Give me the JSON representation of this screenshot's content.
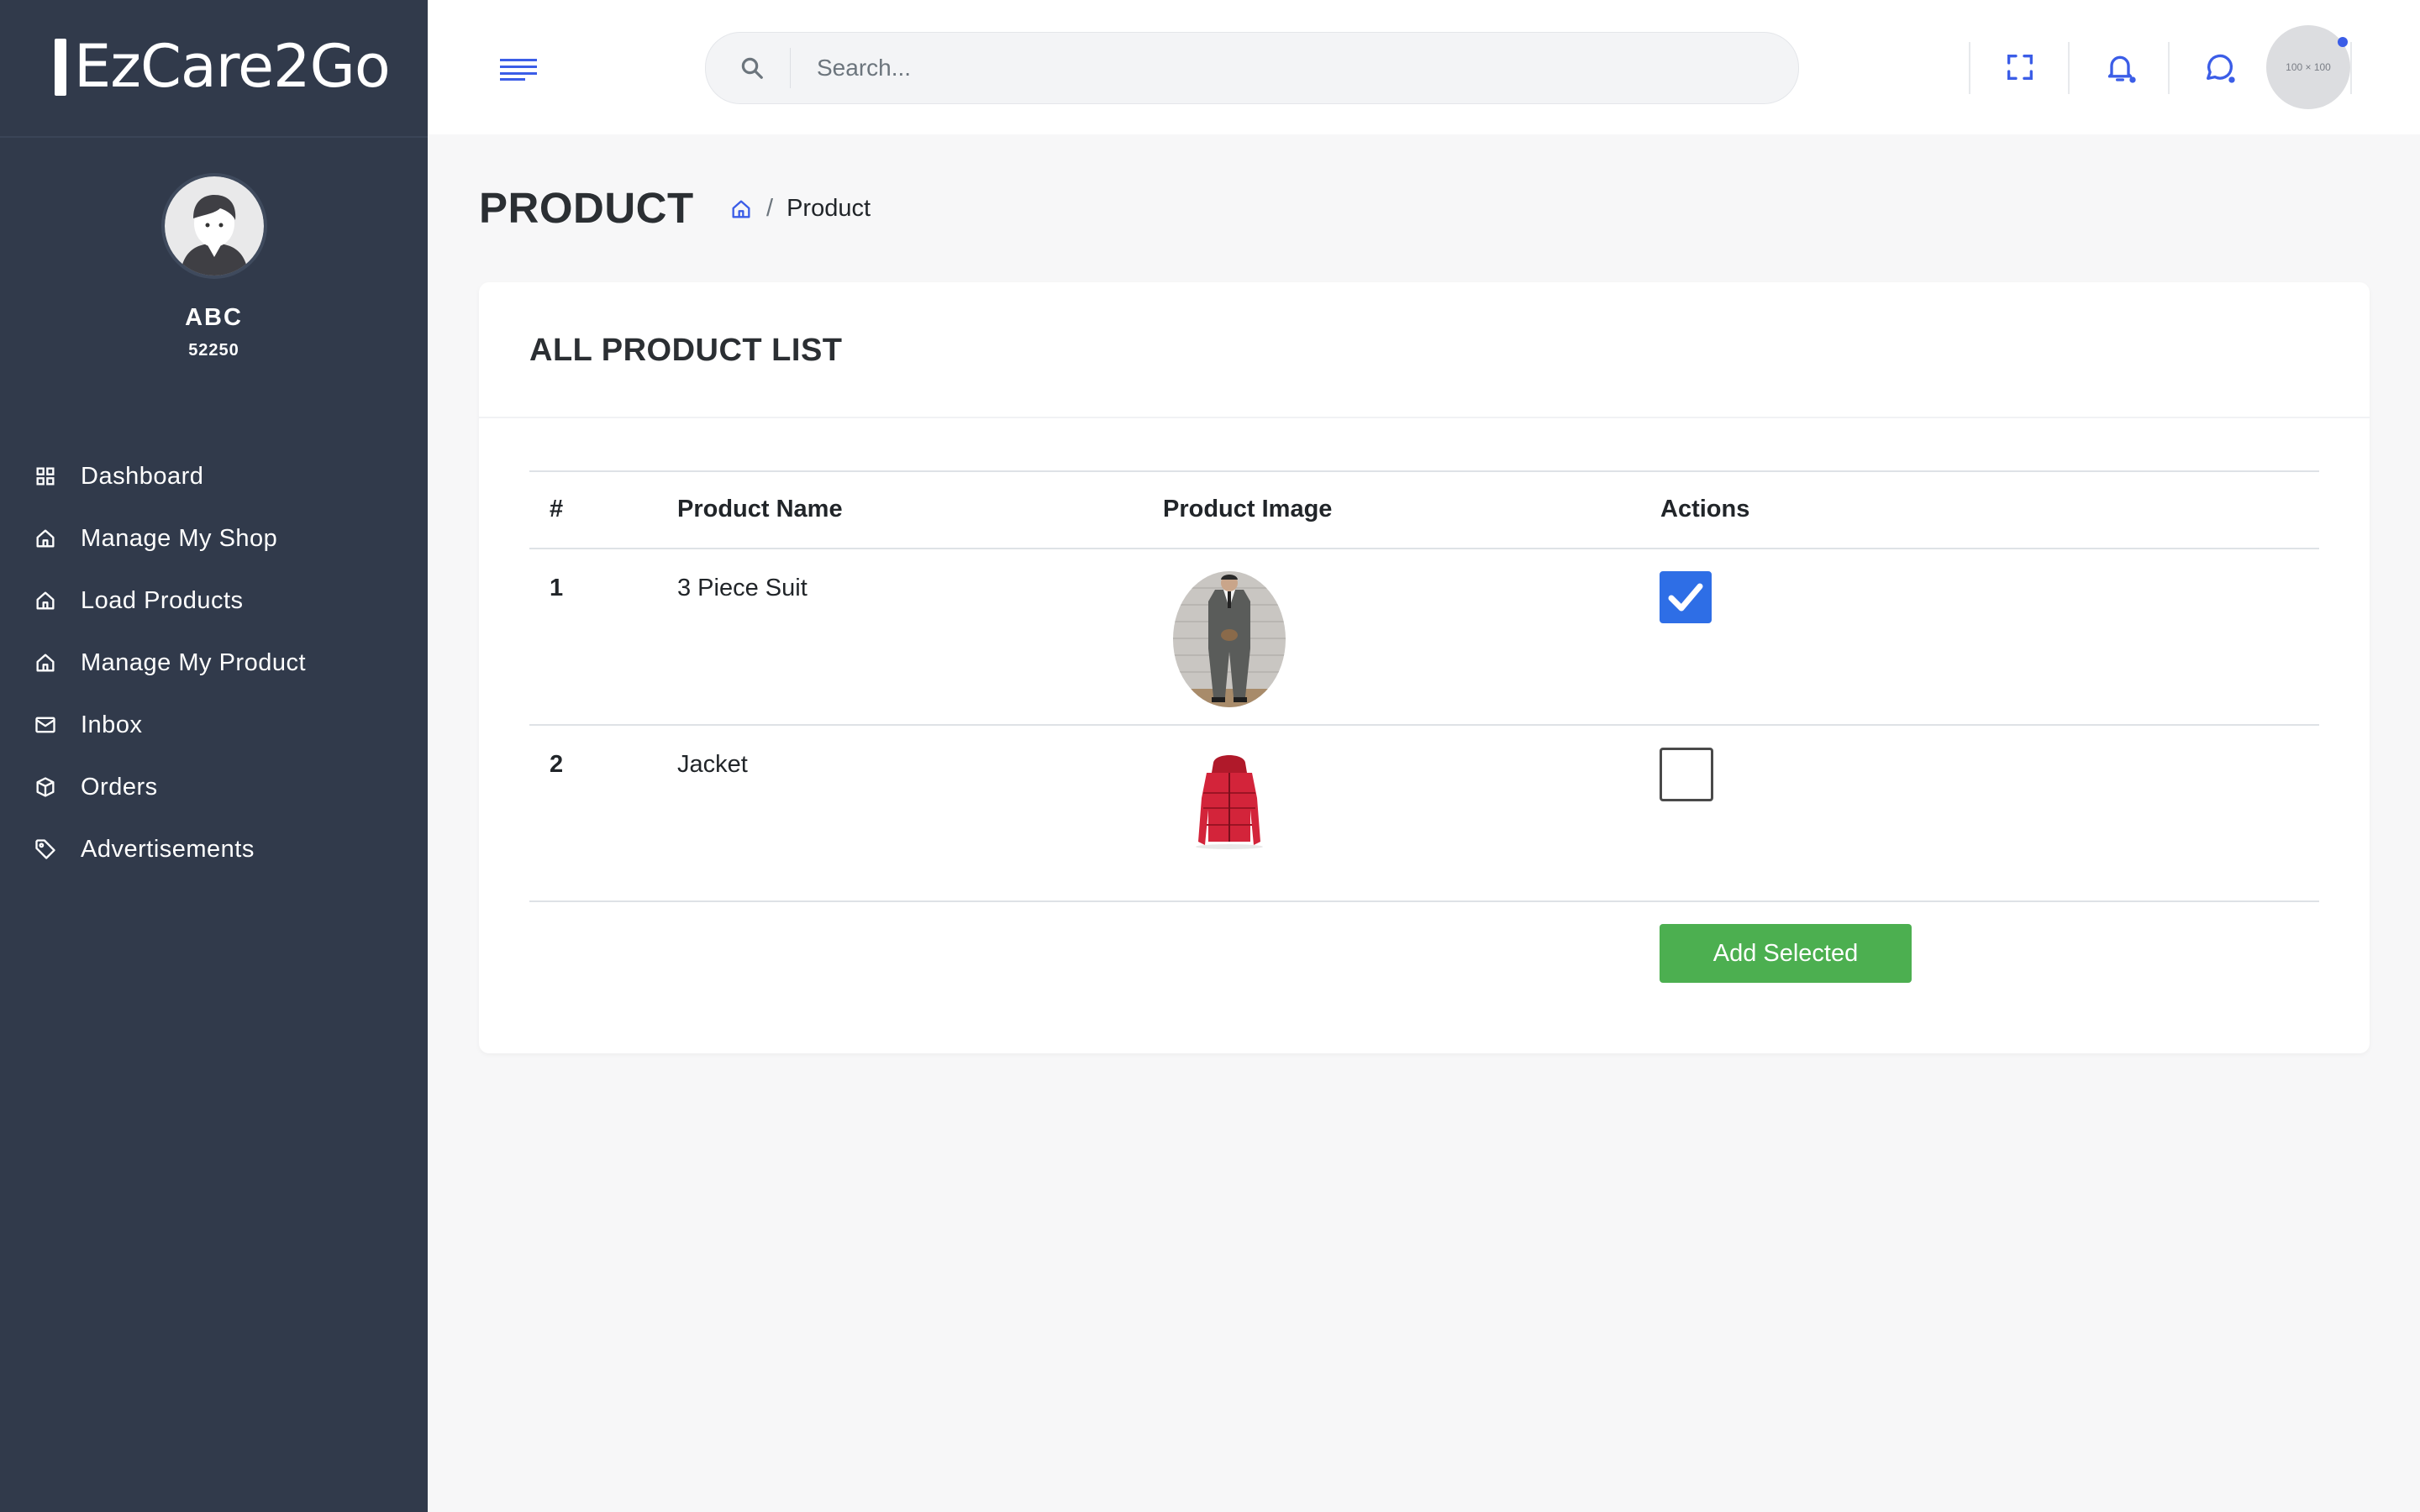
{
  "brand": {
    "name": "EzCare2Go"
  },
  "user": {
    "name": "ABC",
    "id": "52250"
  },
  "sidebar": {
    "items": [
      {
        "label": "Dashboard",
        "icon": "grid-icon"
      },
      {
        "label": "Manage My Shop",
        "icon": "home-icon"
      },
      {
        "label": "Load Products",
        "icon": "home-icon"
      },
      {
        "label": "Manage My Product",
        "icon": "home-icon"
      },
      {
        "label": "Inbox",
        "icon": "mail-icon"
      },
      {
        "label": "Orders",
        "icon": "box-icon"
      },
      {
        "label": "Advertisements",
        "icon": "tag-icon"
      }
    ]
  },
  "topbar": {
    "search_placeholder": "Search...",
    "avatar_placeholder": "100 × 100"
  },
  "page": {
    "title": "PRODUCT"
  },
  "breadcrumb": {
    "separator": "/",
    "current": "Product"
  },
  "card": {
    "title": "ALL PRODUCT LIST",
    "columns": [
      "#",
      "Product Name",
      "Product Image",
      "Actions"
    ],
    "rows": [
      {
        "num": "1",
        "name": "3 Piece Suit",
        "image": "suit-image",
        "checked": true
      },
      {
        "num": "2",
        "name": "Jacket",
        "image": "jacket-image",
        "checked": false
      }
    ],
    "add_button": "Add Selected"
  },
  "colors": {
    "sidebar": "#313a4b",
    "accent": "#3b5de7",
    "checkbox": "#2e6ee6",
    "add_button": "#4caf50"
  }
}
